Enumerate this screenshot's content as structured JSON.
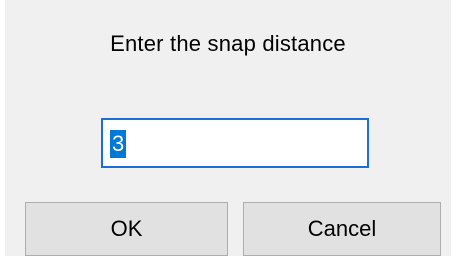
{
  "dialog": {
    "prompt": "Enter the snap distance",
    "input": {
      "value": "3",
      "selected": true
    },
    "buttons": {
      "ok_label": "OK",
      "cancel_label": "Cancel"
    }
  },
  "colors": {
    "dialog_background": "#f0f0f0",
    "input_focus_border": "#1d6fd6",
    "selection_highlight": "#0078d7",
    "button_face": "#e1e1e1",
    "button_border": "#adadad"
  }
}
